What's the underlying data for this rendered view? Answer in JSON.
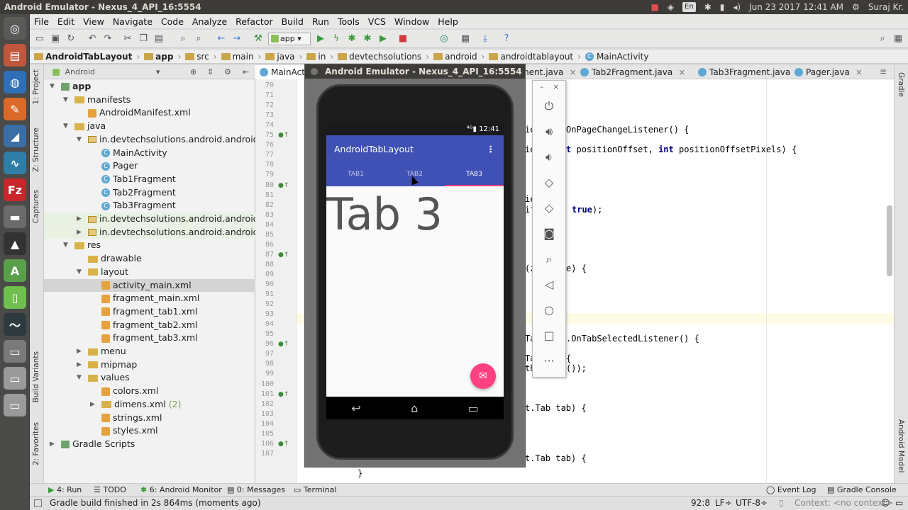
{
  "os_bar": {
    "window_title": "Android Emulator - Nexus_4_API_16:5554",
    "lang": "En",
    "datetime": "Jun 23 2017 12:41 AM",
    "user": "Suraj Kr."
  },
  "menu": [
    "File",
    "Edit",
    "View",
    "Navigate",
    "Code",
    "Analyze",
    "Refactor",
    "Build",
    "Run",
    "Tools",
    "VCS",
    "Window",
    "Help"
  ],
  "toolbar": {
    "run_config": "app"
  },
  "breadcrumb": [
    "AndroidTabLayout",
    "app",
    "src",
    "main",
    "java",
    "in",
    "devtechsolutions",
    "android",
    "androidtablayout",
    "MainActivity"
  ],
  "left_strip": {
    "project": "1: Project",
    "structure": "Z: Structure",
    "captures": "Captures",
    "build_variants": "Build Variants",
    "favorites": "2: Favorites"
  },
  "right_strip": {
    "gradle": "Gradle",
    "android_model": "Android Model"
  },
  "project_panel": {
    "view_mode": "Android",
    "tree": [
      {
        "label": "app",
        "depth": 0,
        "icon": "module",
        "arrow": "down",
        "bold": true
      },
      {
        "label": "manifests",
        "depth": 1,
        "icon": "folder",
        "arrow": "down"
      },
      {
        "label": "AndroidManifest.xml",
        "depth": 2,
        "icon": "xml"
      },
      {
        "label": "java",
        "depth": 1,
        "icon": "folder",
        "arrow": "down"
      },
      {
        "label": "in.devtechsolutions.android.androidtabl",
        "depth": 2,
        "icon": "package",
        "arrow": "down"
      },
      {
        "label": "MainActivity",
        "depth": 3,
        "icon": "class"
      },
      {
        "label": "Pager",
        "depth": 3,
        "icon": "class"
      },
      {
        "label": "Tab1Fragment",
        "depth": 3,
        "icon": "class"
      },
      {
        "label": "Tab2Fragment",
        "depth": 3,
        "icon": "class"
      },
      {
        "label": "Tab3Fragment",
        "depth": 3,
        "icon": "class"
      },
      {
        "label": "in.devtechsolutions.android.androidtabl",
        "depth": 2,
        "icon": "package",
        "arrow": "right",
        "hl": true
      },
      {
        "label": "in.devtechsolutions.android.androidtabl",
        "depth": 2,
        "icon": "package",
        "arrow": "right",
        "hl": true
      },
      {
        "label": "res",
        "depth": 1,
        "icon": "folder",
        "arrow": "down"
      },
      {
        "label": "drawable",
        "depth": 2,
        "icon": "folder"
      },
      {
        "label": "layout",
        "depth": 2,
        "icon": "folder",
        "arrow": "down"
      },
      {
        "label": "activity_main.xml",
        "depth": 3,
        "icon": "xml",
        "selected": true
      },
      {
        "label": "fragment_main.xml",
        "depth": 3,
        "icon": "xml"
      },
      {
        "label": "fragment_tab1.xml",
        "depth": 3,
        "icon": "xml"
      },
      {
        "label": "fragment_tab2.xml",
        "depth": 3,
        "icon": "xml"
      },
      {
        "label": "fragment_tab3.xml",
        "depth": 3,
        "icon": "xml"
      },
      {
        "label": "menu",
        "depth": 2,
        "icon": "folder",
        "arrow": "right"
      },
      {
        "label": "mipmap",
        "depth": 2,
        "icon": "folder",
        "arrow": "right"
      },
      {
        "label": "values",
        "depth": 2,
        "icon": "folder",
        "arrow": "down"
      },
      {
        "label": "colors.xml",
        "depth": 3,
        "icon": "xml"
      },
      {
        "label": "dimens.xml",
        "depth": 3,
        "icon": "folder",
        "arrow": "right",
        "suffix": "(2)"
      },
      {
        "label": "strings.xml",
        "depth": 3,
        "icon": "xml"
      },
      {
        "label": "styles.xml",
        "depth": 3,
        "icon": "xml"
      },
      {
        "label": "Gradle Scripts",
        "depth": 0,
        "icon": "gradle",
        "arrow": "right"
      }
    ]
  },
  "editor_tabs": [
    "MainActi",
    "ment.java",
    "Tab2Fragment.java",
    "Tab3Fragment.java",
    "Pager.java"
  ],
  "line_numbers": [
    "70",
    "71",
    "72",
    "73",
    "74",
    "75",
    "76",
    "77",
    "78",
    "79",
    "80",
    "81",
    "82",
    "83",
    "84",
    "85",
    "86",
    "87",
    "88",
    "89",
    "90",
    "91",
    "92",
    "93",
    "94",
    "95",
    "96",
    "97",
    "98",
    "99",
    "100",
    "101",
    "102",
    "103",
    "104",
    "105",
    "106",
    "107"
  ],
  "code_lines": {
    "l73": "ie",
    "l73b": "OnPageChangeListener() {",
    "l75": "ie",
    "l75b": "t",
    "l75c": "positionOffset,",
    "l75d": "int",
    "l75e": "positionOffsetPixels) {",
    "l80": "ie",
    "l81": "if",
    "l81b": "true",
    "l81c": ");",
    "l87": "(z",
    "l87b": "e) {",
    "l94": "Ta",
    "l94b": ".OnTabSelectedListener() {",
    "l96": "Ta",
    "l96b": "{",
    "l97": "th",
    "l97b": "());",
    "l101": "t.Tab tab) {",
    "l106": "t.Tab tab) {",
    "l107": "}"
  },
  "emulator": {
    "title": "Android Emulator - Nexus_4_API_16:5554",
    "clock": "12:41",
    "app_title": "AndroidTabLayout",
    "tabs": [
      "TAB1",
      "TAB2",
      "TAB3"
    ],
    "selected_tab": 2,
    "content": "Tab 3",
    "accent": "#ff4081",
    "primary": "#3f51b5"
  },
  "bottom_tools": {
    "run": "4: Run",
    "todo": "TODO",
    "monitor": "6: Android Monitor",
    "messages": "0: Messages",
    "terminal": "Terminal",
    "event_log": "Event Log",
    "gradle_console": "Gradle Console"
  },
  "status": {
    "message": "Gradle build finished in 2s 864ms (moments ago)",
    "position": "92:8",
    "line_sep": "LF÷",
    "encoding": "UTF-8÷",
    "context": "Context: <no context>"
  }
}
